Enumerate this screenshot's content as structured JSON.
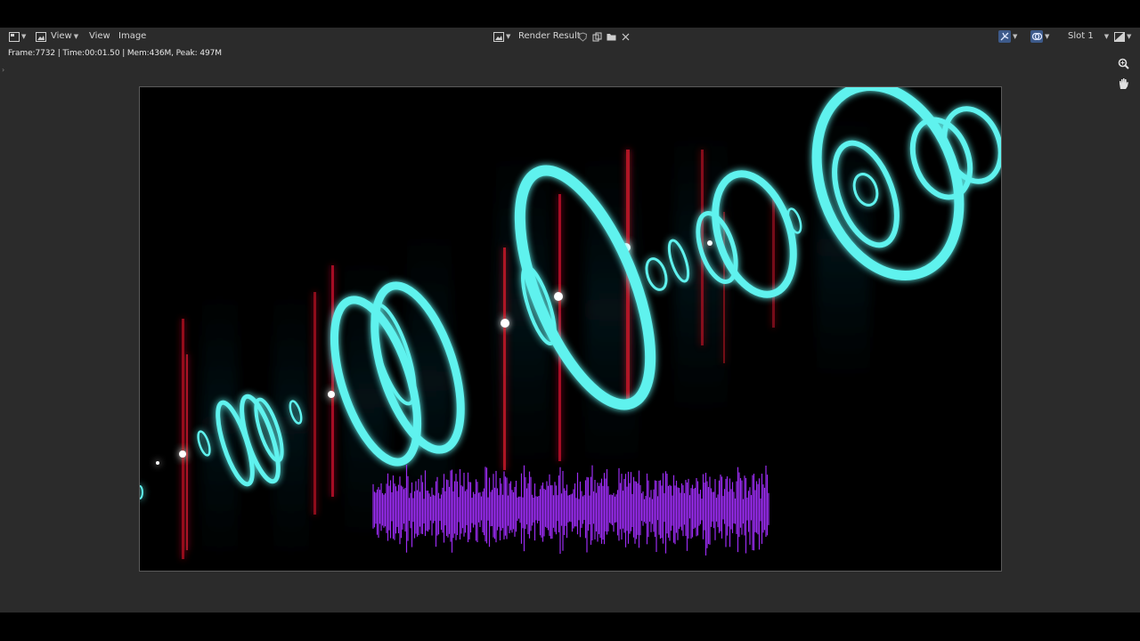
{
  "header": {
    "menus": [
      "View",
      "View",
      "Image"
    ],
    "image_name": "Render Result",
    "slot": "Slot 1"
  },
  "info_bar": {
    "text": "Frame:7732 | Time:00:01.50 | Mem:436M, Peak: 497M"
  },
  "icons": {
    "editor_type": "image-editor-icon",
    "view_mode": "image-mode-icon",
    "image_browse": "image-browse-icon",
    "fake_user": "shield-icon",
    "new_image": "duplicate-icon",
    "open_image": "folder-icon",
    "unlink": "close-icon",
    "gizmo": "gizmo-icon",
    "overlay": "overlay-icon",
    "display_channels": "channels-icon",
    "zoom": "zoom-icon",
    "pan": "hand-icon"
  },
  "colors": {
    "rings": "#5ff2ee",
    "flares": "#c8102e",
    "waveform": "#9a2cf0",
    "editor_bg": "#2b2b2b"
  }
}
